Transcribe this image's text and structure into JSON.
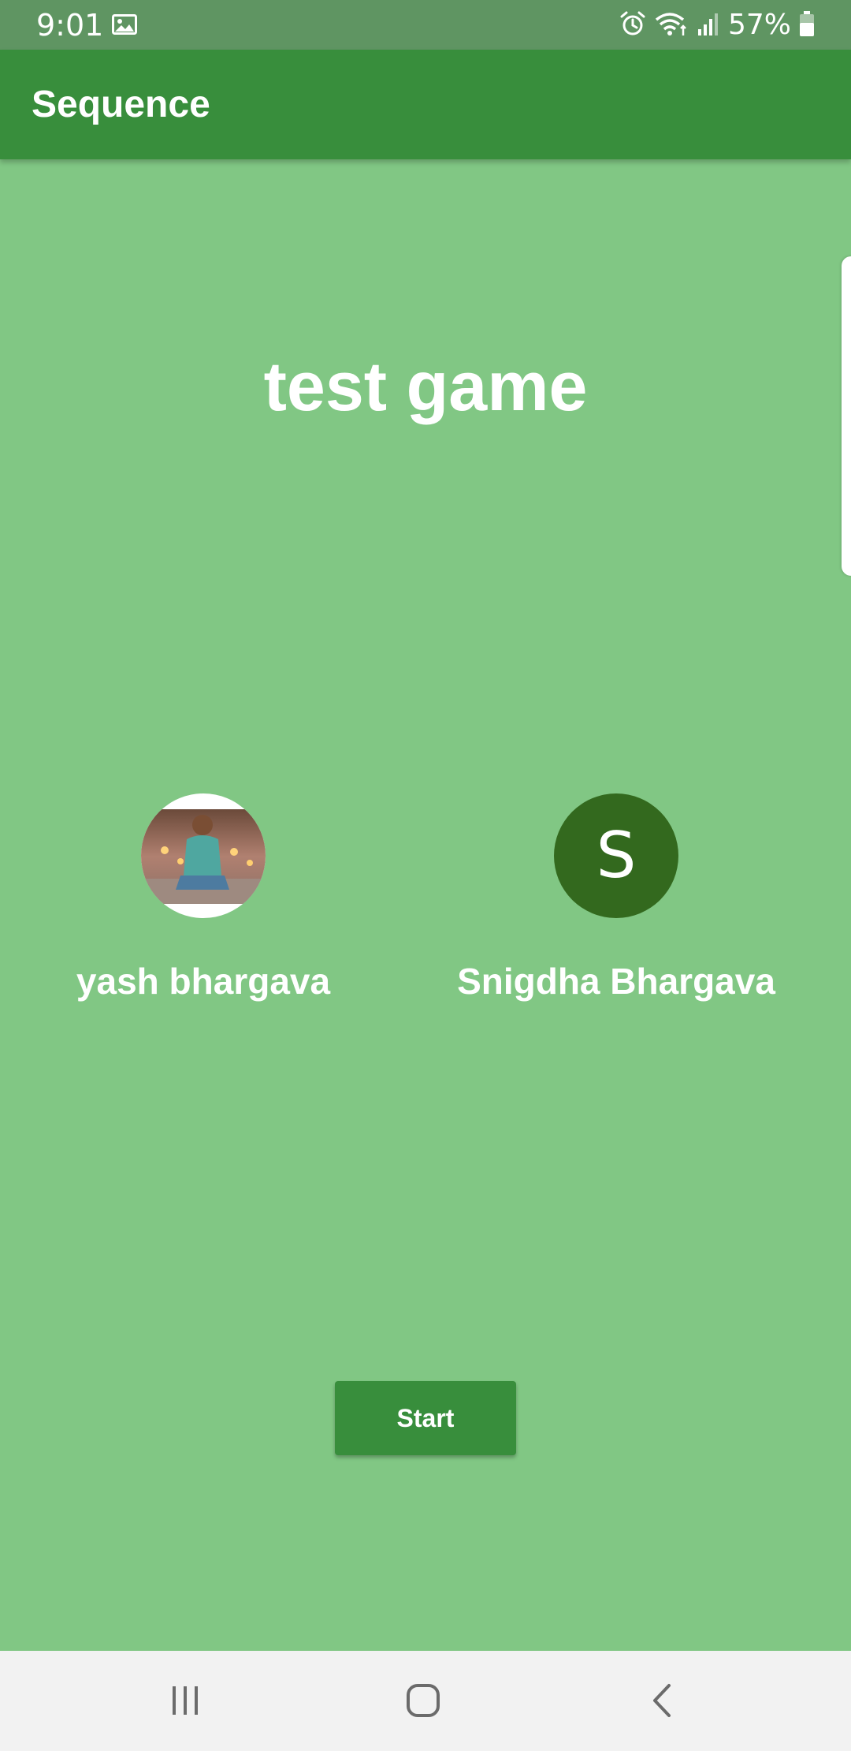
{
  "status_bar": {
    "time": "9:01",
    "battery": "57%",
    "icons": [
      "gallery-icon",
      "alarm-icon",
      "wifi-icon",
      "signal-icon",
      "battery-icon"
    ]
  },
  "app_bar": {
    "title": "Sequence"
  },
  "game": {
    "title": "test game"
  },
  "players": [
    {
      "name": "yash bhargava",
      "avatar_type": "photo"
    },
    {
      "name": "Snigdha Bhargava",
      "avatar_type": "letter",
      "initial": "S",
      "avatar_color": "#33691e"
    }
  ],
  "actions": {
    "start_label": "Start"
  },
  "nav_bar": {
    "icons": [
      "recents-icon",
      "home-icon",
      "back-icon"
    ]
  },
  "colors": {
    "background": "#81c784",
    "app_bar": "#388e3c",
    "status_bar": "#5f9562",
    "button": "#388e3c"
  }
}
